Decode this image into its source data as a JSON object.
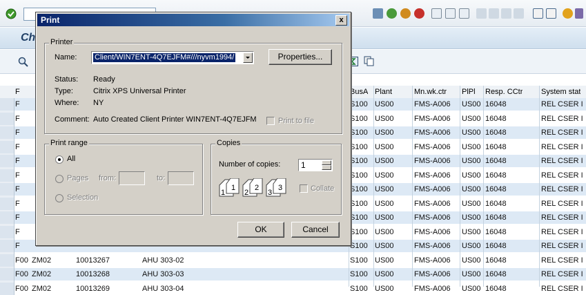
{
  "toolbar": {
    "command_value": ""
  },
  "page": {
    "title_fragment": "Ch"
  },
  "grid": {
    "columns": [
      "F",
      "",
      "",
      "",
      "BusA",
      "Plant",
      "Mn.wk.ctr",
      "PlPl",
      "Resp. CCtr",
      "System stat"
    ],
    "rows": [
      [
        "F",
        "",
        "",
        "",
        "S100",
        "US00",
        "FMS-A006",
        "US00",
        "16048",
        "REL  CSER I"
      ],
      [
        "F",
        "",
        "",
        "",
        "S100",
        "US00",
        "FMS-A006",
        "US00",
        "16048",
        "REL  CSER I"
      ],
      [
        "F",
        "",
        "",
        "",
        "S100",
        "US00",
        "FMS-A006",
        "US00",
        "16048",
        "REL  CSER I"
      ],
      [
        "F",
        "",
        "",
        "",
        "S100",
        "US00",
        "FMS-A006",
        "US00",
        "16048",
        "REL  CSER I"
      ],
      [
        "F",
        "",
        "",
        "",
        "S100",
        "US00",
        "FMS-A006",
        "US00",
        "16048",
        "REL  CSER I"
      ],
      [
        "F",
        "",
        "",
        "",
        "S100",
        "US00",
        "FMS-A006",
        "US00",
        "16048",
        "REL  CSER I"
      ],
      [
        "F",
        "",
        "",
        "",
        "S100",
        "US00",
        "FMS-A006",
        "US00",
        "16048",
        "REL  CSER I"
      ],
      [
        "F",
        "",
        "",
        "",
        "S100",
        "US00",
        "FMS-A006",
        "US00",
        "16048",
        "REL  CSER I"
      ],
      [
        "F",
        "",
        "",
        "",
        "S100",
        "US00",
        "FMS-A006",
        "US00",
        "16048",
        "REL  CSER I"
      ],
      [
        "F",
        "",
        "",
        "",
        "S100",
        "US00",
        "FMS-A006",
        "US00",
        "16048",
        "REL  CSER I"
      ],
      [
        "F",
        "",
        "",
        "",
        "S100",
        "US00",
        "FMS-A006",
        "US00",
        "16048",
        "REL  CSER I"
      ],
      [
        "F00",
        "ZM02",
        "10013267",
        "AHU 303-02",
        "S100",
        "US00",
        "FMS-A006",
        "US00",
        "16048",
        "REL  CSER I"
      ],
      [
        "F00",
        "ZM02",
        "10013268",
        "AHU 303-03",
        "S100",
        "US00",
        "FMS-A006",
        "US00",
        "16048",
        "REL  CSER I"
      ],
      [
        "F00",
        "ZM02",
        "10013269",
        "AHU 303-04",
        "S100",
        "US00",
        "FMS-A006",
        "US00",
        "16048",
        "REL  CSER I"
      ]
    ]
  },
  "dialog": {
    "title": "Print",
    "close": "x",
    "printer_group": "Printer",
    "name_label": "Name:",
    "name_value": "Client/WIN7ENT-4Q7EJFM#///nyvm1994/",
    "properties_button": "Properties...",
    "status_label": "Status:",
    "status_value": "Ready",
    "type_label": "Type:",
    "type_value": "Citrix XPS Universal Printer",
    "where_label": "Where:",
    "where_value": "NY",
    "comment_label": "Comment:",
    "comment_value": "Auto Created Client Printer WIN7ENT-4Q7EJFM",
    "print_to_file": "Print to file",
    "range_group": "Print range",
    "range_all": "All",
    "range_pages": "Pages",
    "range_from": "from:",
    "range_to": "to:",
    "range_selection": "Selection",
    "copies_group": "Copies",
    "copies_label": "Number of copies:",
    "copies_value": "1",
    "collate": "Collate",
    "ok": "OK",
    "cancel": "Cancel"
  },
  "colors": {
    "row_blue": "#dde9f5",
    "row_white": "#ffffff",
    "titlebar": "#0a246a"
  }
}
